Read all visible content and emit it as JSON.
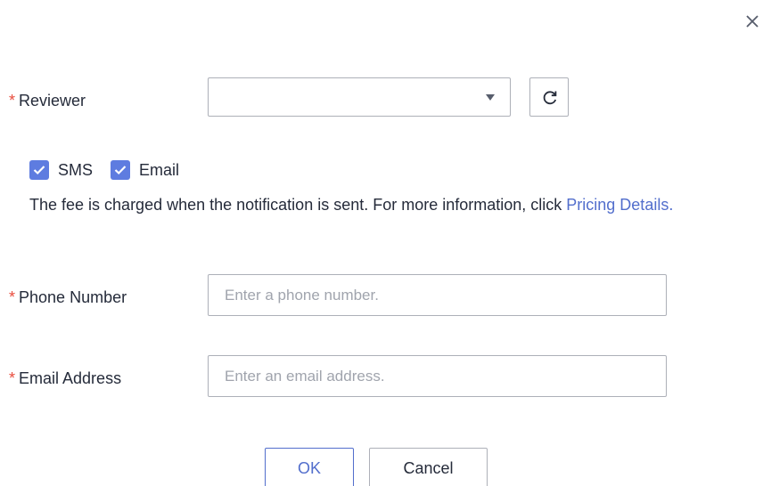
{
  "dialog": {
    "close_icon": "close-icon"
  },
  "reviewer": {
    "required_mark": "*",
    "label": "Reviewer",
    "selected_value": "",
    "caret_icon": "caret-down-icon",
    "refresh_icon": "refresh-icon"
  },
  "notification": {
    "methods": [
      {
        "label": "SMS",
        "checked": true
      },
      {
        "label": "Email",
        "checked": true
      }
    ],
    "notice_text": "The fee is charged when the notification is sent. For more information, click ",
    "pricing_link": "Pricing Details."
  },
  "phone": {
    "required_mark": "*",
    "label": "Phone Number",
    "value": "",
    "placeholder": "Enter a phone number."
  },
  "email": {
    "required_mark": "*",
    "label": "Email Address",
    "value": "",
    "placeholder": "Enter an email address."
  },
  "footer": {
    "ok_label": "OK",
    "cancel_label": "Cancel"
  },
  "colors": {
    "accent": "#526ecc",
    "checkbox": "#5e7ce0",
    "required": "#e84c3d",
    "border": "#adb0b8"
  }
}
